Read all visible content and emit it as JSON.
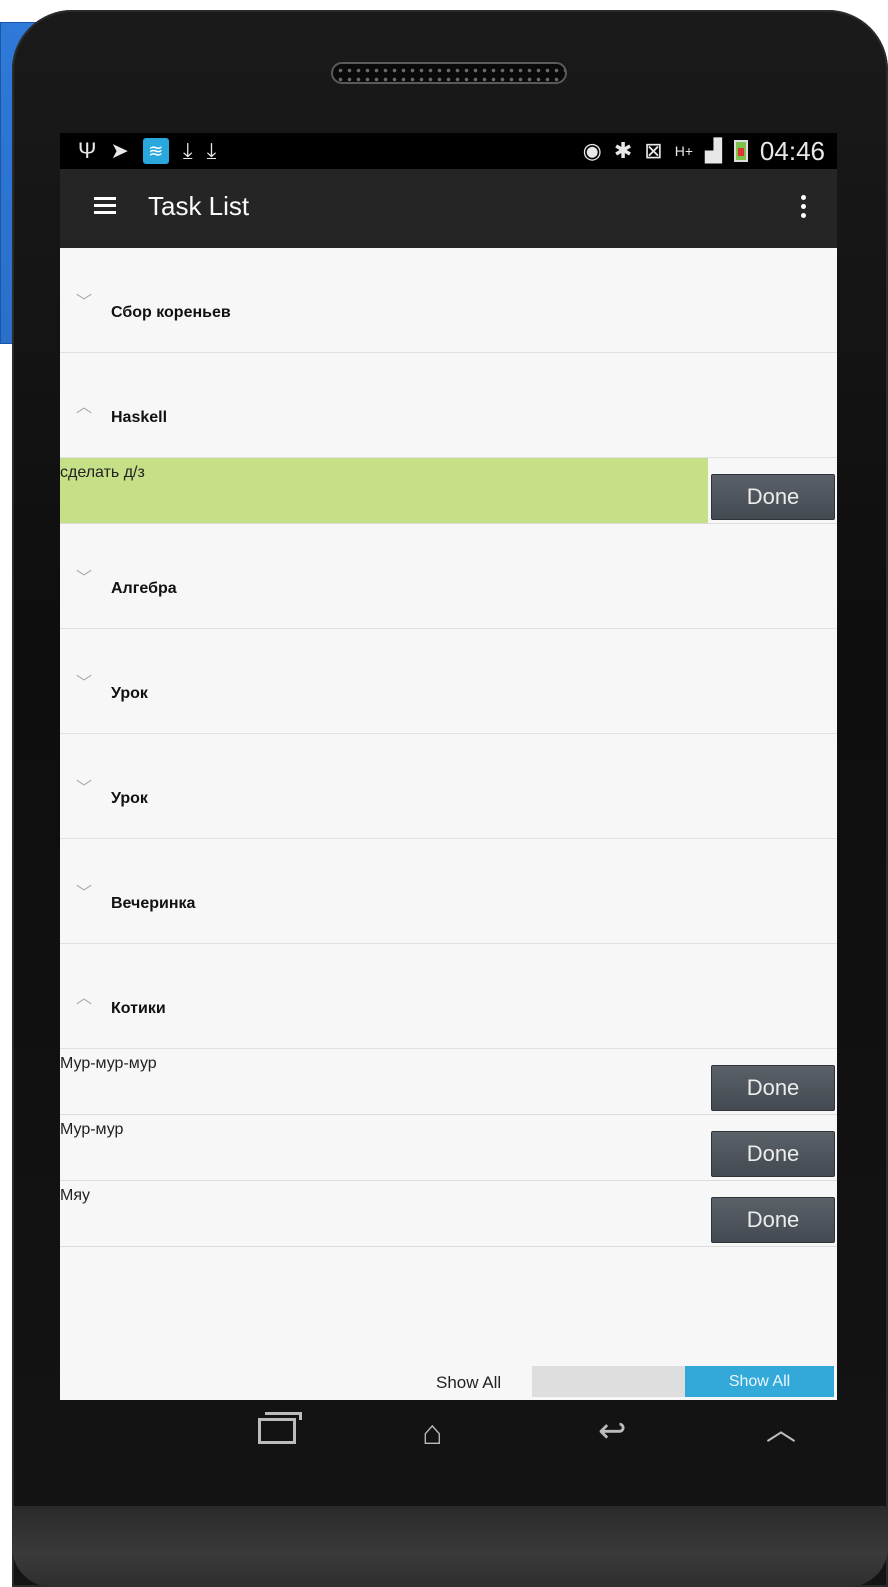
{
  "status_bar": {
    "left_icons": [
      "usb-icon",
      "navigation-icon",
      "wifi-icon",
      "download-icon",
      "download-icon"
    ],
    "right_icons": [
      "eye-icon",
      "bluetooth-icon",
      "mute-icon",
      "hplus-icon",
      "signal-icon",
      "battery-icon"
    ],
    "time": "04:46"
  },
  "app_bar": {
    "title": "Task List"
  },
  "list": [
    {
      "type": "group",
      "title": "Сбор кореньев",
      "expanded": false
    },
    {
      "type": "group",
      "title": "Haskell",
      "expanded": true
    },
    {
      "type": "task",
      "text": "сделать д/з",
      "button": "Done",
      "highlight": true
    },
    {
      "type": "group",
      "title": "Алгебра",
      "expanded": false
    },
    {
      "type": "group",
      "title": "Урок",
      "expanded": false
    },
    {
      "type": "group",
      "title": "Урок",
      "expanded": false
    },
    {
      "type": "group",
      "title": "Вечеринка",
      "expanded": false
    },
    {
      "type": "group",
      "title": "Котики",
      "expanded": true
    },
    {
      "type": "task",
      "text": "Мур-мур-мур",
      "button": "Done",
      "highlight": false
    },
    {
      "type": "task",
      "text": "Мур-мур",
      "button": "Done",
      "highlight": false
    },
    {
      "type": "task",
      "text": "Мяу",
      "button": "Done",
      "highlight": false
    }
  ],
  "footer": {
    "show_all_label": "Show All",
    "toggle_on_label": "Show All"
  },
  "colors": {
    "highlight": "#c6e087",
    "toggle_accent": "#33a9d9",
    "app_bar": "#252525"
  }
}
